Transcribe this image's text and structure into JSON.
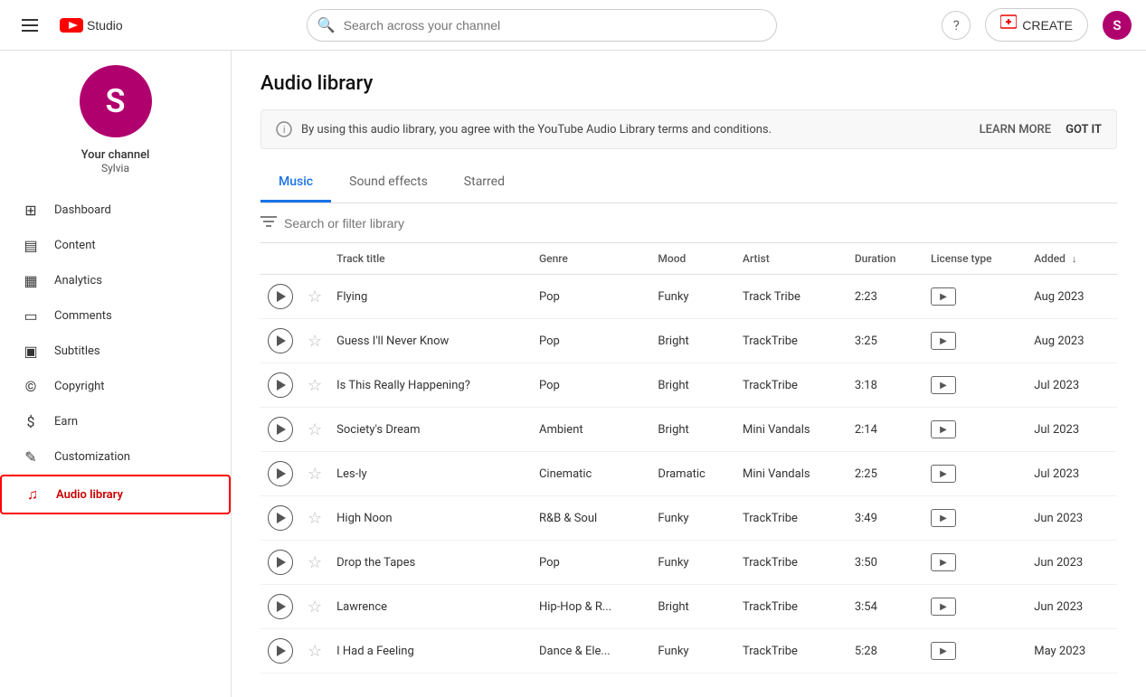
{
  "app": {
    "title": "YouTube Studio",
    "logo_text": "Studio"
  },
  "header": {
    "search_placeholder": "Search across your channel",
    "help_icon": "?",
    "create_label": "CREATE",
    "avatar_letter": "S"
  },
  "sidebar": {
    "avatar_letter": "S",
    "channel_title": "Your channel",
    "channel_name": "Sylvia",
    "nav_items": [
      {
        "id": "dashboard",
        "label": "Dashboard",
        "icon": "⊞"
      },
      {
        "id": "content",
        "label": "Content",
        "icon": "▤"
      },
      {
        "id": "analytics",
        "label": "Analytics",
        "icon": "▦"
      },
      {
        "id": "comments",
        "label": "Comments",
        "icon": "▭"
      },
      {
        "id": "subtitles",
        "label": "Subtitles",
        "icon": "▣"
      },
      {
        "id": "copyright",
        "label": "Copyright",
        "icon": "©"
      },
      {
        "id": "earn",
        "label": "Earn",
        "icon": "$"
      },
      {
        "id": "customization",
        "label": "Customization",
        "icon": "✎"
      },
      {
        "id": "audio-library",
        "label": "Audio library",
        "icon": "♫",
        "active": true
      }
    ]
  },
  "page": {
    "title": "Audio library",
    "notice_text": "By using this audio library, you agree with the YouTube Audio Library terms and conditions.",
    "learn_more_label": "LEARN MORE",
    "got_it_label": "GOT IT",
    "tabs": [
      {
        "id": "music",
        "label": "Music",
        "active": true
      },
      {
        "id": "sound-effects",
        "label": "Sound effects",
        "active": false
      },
      {
        "id": "starred",
        "label": "Starred",
        "active": false
      }
    ],
    "filter_placeholder": "Search or filter library",
    "table": {
      "columns": [
        {
          "id": "actions",
          "label": ""
        },
        {
          "id": "track-title",
          "label": "Track title",
          "color": ""
        },
        {
          "id": "genre",
          "label": "Genre",
          "color": ""
        },
        {
          "id": "mood",
          "label": "Mood",
          "color": "mood"
        },
        {
          "id": "artist",
          "label": "Artist",
          "color": "artist"
        },
        {
          "id": "duration",
          "label": "Duration",
          "color": ""
        },
        {
          "id": "license-type",
          "label": "License type",
          "color": "license"
        },
        {
          "id": "added",
          "label": "Added",
          "color": "added",
          "sort": "desc"
        }
      ],
      "rows": [
        {
          "title": "Flying",
          "genre": "Pop",
          "mood": "Funky",
          "artist": "Track Tribe",
          "duration": "2:23",
          "added": "Aug 2023"
        },
        {
          "title": "Guess I'll Never Know",
          "genre": "Pop",
          "mood": "Bright",
          "artist": "TrackTribe",
          "duration": "3:25",
          "added": "Aug 2023"
        },
        {
          "title": "Is This Really Happening?",
          "genre": "Pop",
          "mood": "Bright",
          "artist": "TrackTribe",
          "duration": "3:18",
          "added": "Jul 2023"
        },
        {
          "title": "Society's Dream",
          "genre": "Ambient",
          "mood": "Bright",
          "artist": "Mini Vandals",
          "duration": "2:14",
          "added": "Jul 2023"
        },
        {
          "title": "Les-ly",
          "genre": "Cinematic",
          "mood": "Dramatic",
          "artist": "Mini Vandals",
          "duration": "2:25",
          "added": "Jul 2023"
        },
        {
          "title": "High Noon",
          "genre": "R&B & Soul",
          "mood": "Funky",
          "artist": "TrackTribe",
          "duration": "3:49",
          "added": "Jun 2023"
        },
        {
          "title": "Drop the Tapes",
          "genre": "Pop",
          "mood": "Funky",
          "artist": "TrackTribe",
          "duration": "3:50",
          "added": "Jun 2023"
        },
        {
          "title": "Lawrence",
          "genre": "Hip-Hop & R...",
          "mood": "Bright",
          "artist": "TrackTribe",
          "duration": "3:54",
          "added": "Jun 2023"
        },
        {
          "title": "I Had a Feeling",
          "genre": "Dance & Ele...",
          "mood": "Funky",
          "artist": "TrackTribe",
          "duration": "5:28",
          "added": "May 2023"
        }
      ]
    }
  }
}
